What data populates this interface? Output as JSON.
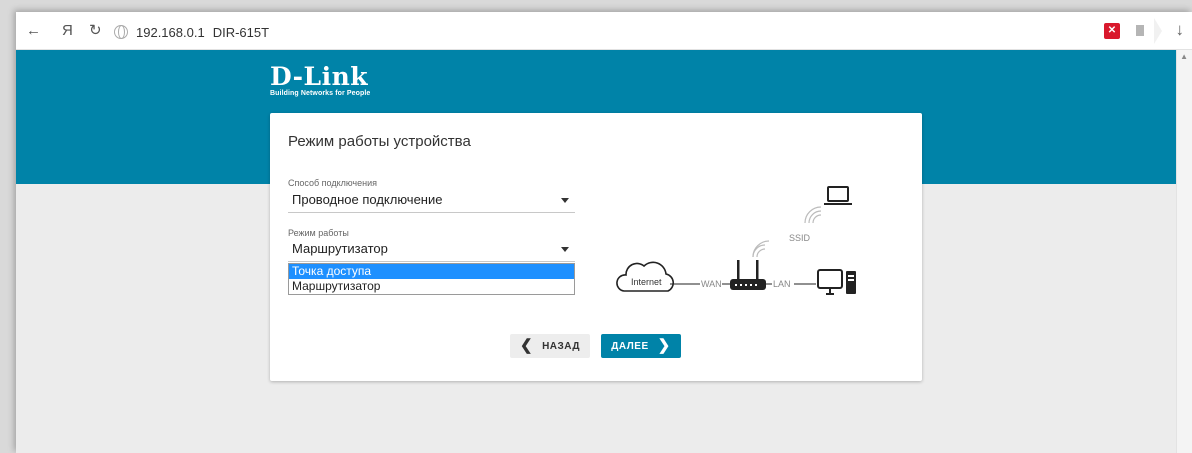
{
  "browser": {
    "back_icon": "←",
    "yandex_icon": "Я",
    "reload_icon": "↻",
    "host": "192.168.0.1",
    "page_title": "DIR-615T",
    "download_icon": "↓"
  },
  "logo": {
    "wordmark": "D-Link",
    "tagline": "Building Networks for People"
  },
  "card": {
    "title": "Режим работы устройства",
    "connection": {
      "label": "Способ подключения",
      "value": "Проводное подключение"
    },
    "mode": {
      "label": "Режим работы",
      "value": "Маршрутизатор",
      "options": [
        "Точка доступа",
        "Маршрутизатор"
      ],
      "highlighted": "Точка доступа"
    },
    "diagram": {
      "internet": "Internet",
      "wan": "WAN",
      "lan": "LAN",
      "ssid": "SSID"
    },
    "buttons": {
      "back": "НАЗАД",
      "next": "ДАЛЕЕ"
    }
  },
  "colors": {
    "brand": "#0083a8",
    "highlight": "#1e90ff",
    "extension": "#d9182c"
  }
}
